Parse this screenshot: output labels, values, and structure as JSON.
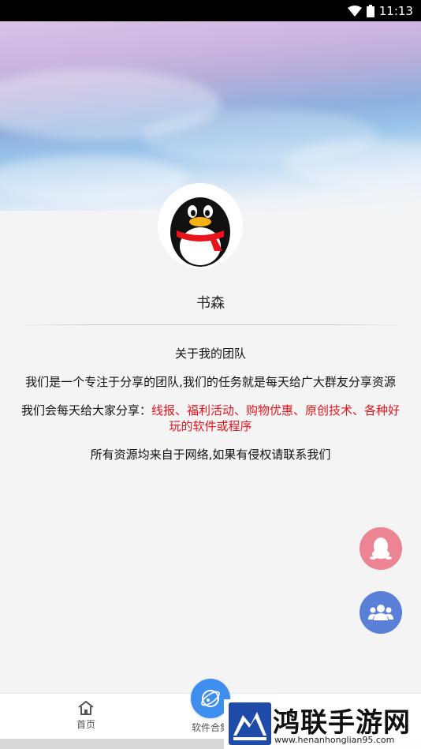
{
  "status_bar": {
    "time": "11:13",
    "wifi_icon": "wifi-icon",
    "battery_icon": "battery-icon"
  },
  "profile": {
    "avatar_icon": "qq-penguin-avatar",
    "name": "书森"
  },
  "about": {
    "heading": "关于我的团队",
    "intro": "我们是一个专注于分享的团队,我们的任务就是每天给广大群友分享资源",
    "share_prefix": "我们会每天给大家分享：",
    "share_items": "线报、福利活动、购物优惠、原创技术、各种好玩的软件或程序",
    "disclaimer": "所有资源均来自于网络,如果有侵权请联系我们"
  },
  "fabs": {
    "qq_icon": "qq-penguin-icon",
    "group_icon": "group-icon"
  },
  "bottom_nav": {
    "home_label": "首页",
    "home_icon": "home-icon",
    "apps_label": "软件合集",
    "apps_icon": "planet-icon"
  },
  "watermark": {
    "title": "鸿联手游网",
    "url": "www.henanhonglian95.com"
  },
  "colors": {
    "accent_red": "#e8141b",
    "fab_pink": "#ec8493",
    "fab_blue": "#5a7fd6",
    "center_blue": "#3e8ef0"
  }
}
